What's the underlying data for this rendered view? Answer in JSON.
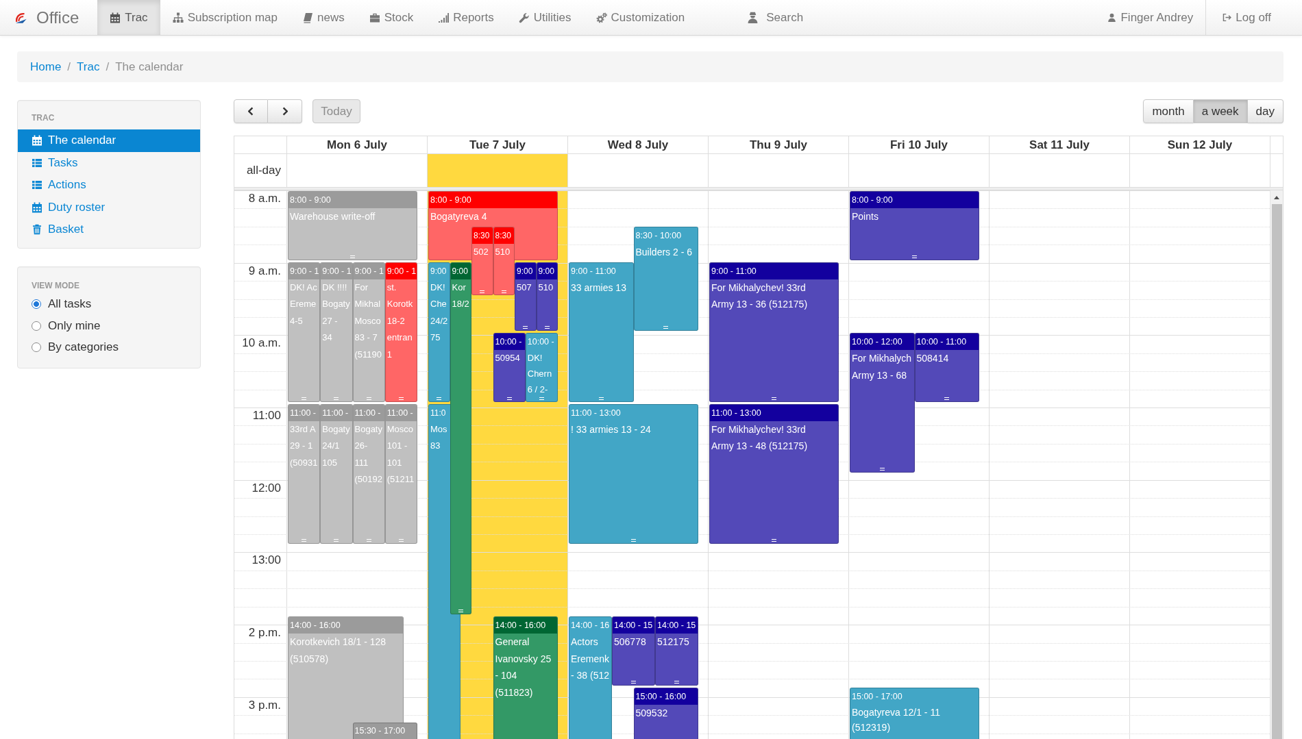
{
  "navbar": {
    "brand": "Office",
    "items": [
      {
        "label": "Trac",
        "selected": true
      },
      {
        "label": "Subscription map",
        "selected": false
      },
      {
        "label": "news",
        "selected": false
      },
      {
        "label": "Stock",
        "selected": false
      },
      {
        "label": "Reports",
        "selected": false
      },
      {
        "label": "Utilities",
        "selected": false
      },
      {
        "label": "Customization",
        "selected": false
      }
    ],
    "search": "Search",
    "user": "Finger Andrey",
    "logout": "Log off"
  },
  "breadcrumb": {
    "items": [
      {
        "label": "Home",
        "current": false
      },
      {
        "label": "Trac",
        "current": false
      },
      {
        "label": "The calendar",
        "current": true
      }
    ],
    "separators": [
      "/",
      "/"
    ]
  },
  "sidebar": {
    "menu": {
      "title": "TRAC",
      "items": [
        {
          "label": "The calendar",
          "selected": true
        },
        {
          "label": "Tasks",
          "selected": false
        },
        {
          "label": "Actions",
          "selected": false
        },
        {
          "label": "Duty roster",
          "selected": false
        },
        {
          "label": "Basket",
          "selected": false
        }
      ]
    },
    "view_mode": {
      "title": "VIEW MODE",
      "options": [
        {
          "label": "All tasks",
          "selected": true
        },
        {
          "label": "Only mine",
          "selected": false
        },
        {
          "label": "By categories",
          "selected": false
        }
      ]
    }
  },
  "calendar": {
    "toolbar": {
      "today": {
        "label": "Today",
        "disabled": true
      },
      "views": [
        {
          "label": "month",
          "selected": false
        },
        {
          "label": "a week",
          "selected": true
        },
        {
          "label": "day",
          "selected": false
        }
      ]
    },
    "allday_label": "all-day",
    "hours": [
      "8 a.m.",
      "9 a.m.",
      "10 a.m.",
      "11:00",
      "12:00",
      "13:00",
      "2 p.m.",
      "3 p.m."
    ],
    "days": [
      {
        "label": "Mon 6 July",
        "today": false,
        "events": [
          {
            "time": {
              "label": "8:00 - 9:00",
              "color": "#9b9b9b"
            },
            "title": "Warehouse write-off",
            "color": "#c0c0c0"
          },
          {
            "time": {
              "label": "9:00 - 1",
              "color": "#9b9b9b"
            },
            "title": "DK! Ac\nEreme\n4-5",
            "color": "#c0c0c0"
          },
          {
            "time": {
              "label": "9:00 - 1",
              "color": "#9b9b9b"
            },
            "title": "DK !!!!\nBogaty\n27 -\n34",
            "color": "#c0c0c0"
          },
          {
            "time": {
              "label": "9:00 - 1",
              "color": "#9b9b9b"
            },
            "title": "For\nMikhal\nMosco\n83 - 7\n(51190",
            "color": "#c0c0c0"
          },
          {
            "time": {
              "label": "9:00 - 1",
              "color": "#ff0000"
            },
            "title": "st.\nKorotk\n18-2\nentran\n1",
            "color": "#ff6666"
          },
          {
            "time": {
              "label": "11:00 -",
              "color": "#9b9b9b"
            },
            "title": "33rd A\n29 - 1\n(50931",
            "color": "#c0c0c0"
          },
          {
            "time": {
              "label": "11:00 -",
              "color": "#9b9b9b"
            },
            "title": "Bogaty\n24/1\n105",
            "color": "#c0c0c0"
          },
          {
            "time": {
              "label": "11:00 -",
              "color": "#9b9b9b"
            },
            "title": "Bogaty\n26-\n111\n(50192",
            "color": "#c0c0c0"
          },
          {
            "time": {
              "label": "11:00 -",
              "color": "#9b9b9b"
            },
            "title": "Mosco\n101 -\n101\n(51211",
            "color": "#c0c0c0"
          },
          {
            "time": {
              "label": "14:00 - 16:00",
              "color": "#9b9b9b"
            },
            "title": "Korotkevich 18/1 - 128\n(510578)",
            "color": "#c0c0c0"
          },
          {
            "time": {
              "label": "15:30 - 17:00",
              "color": "#9b9b9b"
            }
          }
        ]
      },
      {
        "label": "Tue 7 July",
        "today": true,
        "events": [
          {
            "time": {
              "label": "8:00 - 9:00",
              "color": "#ff0000"
            },
            "title": "Bogatyreva 4",
            "color": "#ff6666"
          },
          {
            "time": {
              "label": "8:30",
              "color": "#ff0000"
            },
            "title": "502",
            "color": "#ff6666"
          },
          {
            "time": {
              "label": "8:30",
              "color": "#ff0000"
            },
            "title": "510",
            "color": "#ff6666"
          },
          {
            "time": {
              "label": "9:00",
              "color": "#42a6c6"
            },
            "title": "DK!\nChe\n24/2\n75",
            "color": "#42a6c6"
          },
          {
            "time": {
              "label": "9:00",
              "color": "#006633"
            },
            "title": "Kor\n18/2",
            "color": "#339966"
          },
          {
            "time": {
              "label": "9:00",
              "color": "#13009e"
            },
            "title": "507",
            "color": "#5349b8"
          },
          {
            "time": {
              "label": "9:00",
              "color": "#13009e"
            },
            "title": "510",
            "color": "#5349b8"
          },
          {
            "time": {
              "label": "10:00 -",
              "color": "#13009e"
            },
            "title": "50954",
            "color": "#5349b8"
          },
          {
            "time": {
              "label": "10:00 -",
              "color": "#42a6c6"
            },
            "title": "DK!\nChern\n6 / 2-",
            "color": "#42a6c6"
          },
          {
            "time": {
              "label": "11:0",
              "color": "#42a6c6"
            },
            "title": "Mos\n83",
            "color": "#42a6c6"
          },
          {
            "time": {
              "label": "14:00 - 16:00",
              "color": "#006633"
            },
            "title": "General\nIvanovsky 25\n- 104\n(511823)",
            "color": "#339966"
          }
        ]
      },
      {
        "label": "Wed 8 July",
        "today": false,
        "events": [
          {
            "time": {
              "label": "8:30 - 10:00",
              "color": "#42a6c6"
            },
            "title": "Builders 2 - 6",
            "color": "#42a6c6"
          },
          {
            "time": {
              "label": "9:00 - 11:00",
              "color": "#42a6c6"
            },
            "title": "33 armies 13",
            "color": "#42a6c6"
          },
          {
            "time": {
              "label": "11:00 - 13:00",
              "color": "#42a6c6"
            },
            "title": "! 33 armies 13 - 24",
            "color": "#42a6c6"
          },
          {
            "time": {
              "label": "14:00 - 16",
              "color": "#42a6c6"
            },
            "title": "Actors\nEremenk\n- 38 (512",
            "color": "#42a6c6"
          },
          {
            "time": {
              "label": "14:00 - 15",
              "color": "#13009e"
            },
            "title": "506778",
            "color": "#5349b8"
          },
          {
            "time": {
              "label": "14:00 - 15",
              "color": "#13009e"
            },
            "title": "512175",
            "color": "#5349b8"
          },
          {
            "time": {
              "label": "15:00 - 16:00",
              "color": "#13009e"
            },
            "title": "509532",
            "color": "#5349b8"
          }
        ]
      },
      {
        "label": "Thu 9 July",
        "today": false,
        "events": [
          {
            "time": {
              "label": "9:00 - 11:00",
              "color": "#13009e"
            },
            "title": "For Mikhalychev! 33rd\nArmy 13 - 36 (512175)",
            "color": "#5349b8"
          },
          {
            "time": {
              "label": "11:00 - 13:00",
              "color": "#13009e"
            },
            "title": "For Mikhalychev! 33rd\nArmy 13 - 48 (512175)",
            "color": "#5349b8"
          }
        ]
      },
      {
        "label": "Fri 10 July",
        "today": false,
        "events": [
          {
            "time": {
              "label": "8:00 - 9:00",
              "color": "#13009e"
            },
            "title": "Points",
            "color": "#5349b8"
          },
          {
            "time": {
              "label": "10:00 - 12:00",
              "color": "#13009e"
            },
            "title": "For Mikhalych\nArmy 13 - 68",
            "color": "#5349b8"
          },
          {
            "time": {
              "label": "10:00 - 11:00",
              "color": "#13009e"
            },
            "title": "508414",
            "color": "#5349b8"
          },
          {
            "time": {
              "label": "15:00 - 17:00",
              "color": "#42a6c6"
            },
            "title": "Bogatyreva 12/1 - 11\n(512319)",
            "color": "#42a6c6"
          }
        ]
      },
      {
        "label": "Sat 11 July",
        "today": false
      },
      {
        "label": "Sun 12 July",
        "today": false
      }
    ]
  }
}
